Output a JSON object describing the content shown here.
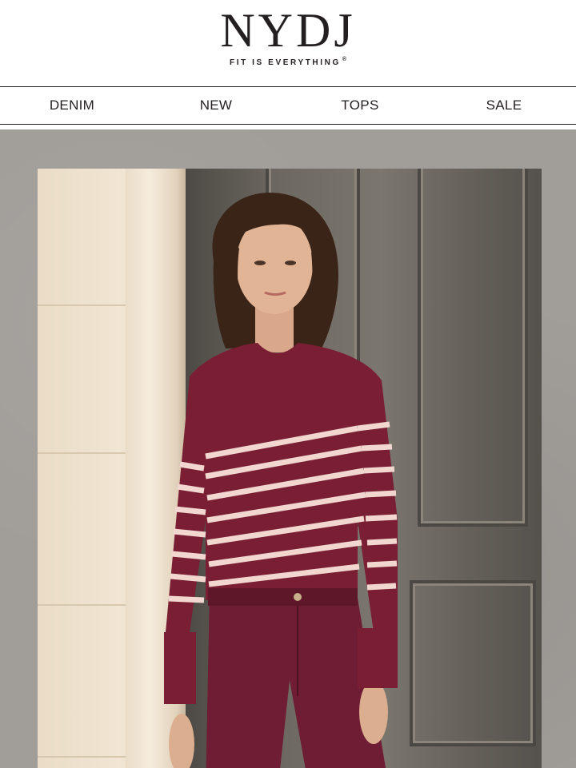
{
  "brand": {
    "name": "NYDJ",
    "tagline": "FIT IS EVERYTHING",
    "registered_mark": "®"
  },
  "nav": {
    "items": [
      {
        "label": "DENIM"
      },
      {
        "label": "NEW"
      },
      {
        "label": "TOPS"
      },
      {
        "label": "SALE"
      }
    ]
  },
  "hero": {
    "image": "woman-in-striped-sweater-photo",
    "colors": {
      "sweater": "#7a1e33",
      "stripes": "#f2d6d0",
      "jeans": "#6e1d35",
      "backdrop": "#a19d99"
    }
  }
}
